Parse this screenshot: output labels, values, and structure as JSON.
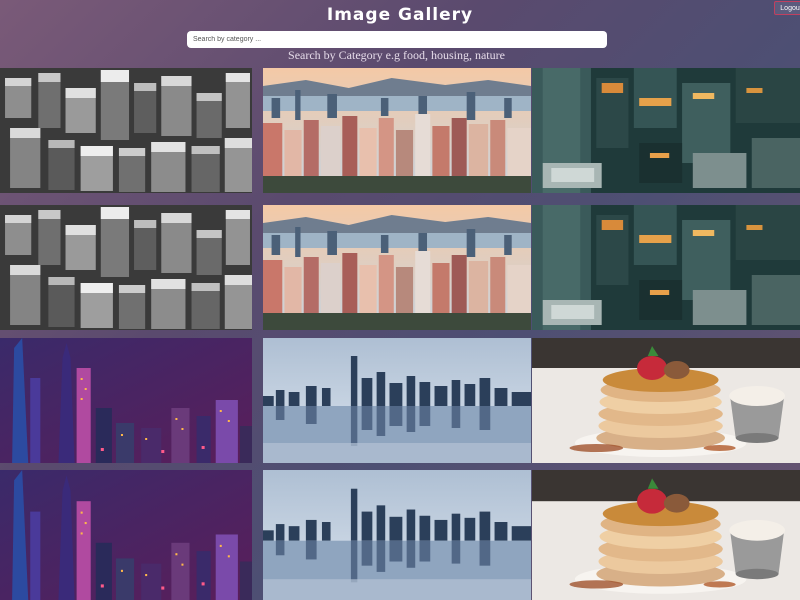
{
  "header": {
    "title": "Image Gallery",
    "logout_label": "Logout",
    "search_placeholder": "Search by category ...",
    "search_value": "",
    "hint": "Search by Category e.g food, housing, nature"
  },
  "gallery": {
    "images": [
      {
        "subject": "bw-city-aerial"
      },
      {
        "subject": "harbor-city-sunset"
      },
      {
        "subject": "teal-orange-rooftops"
      },
      {
        "subject": "bw-city-aerial"
      },
      {
        "subject": "harbor-city-sunset"
      },
      {
        "subject": "teal-orange-rooftops"
      },
      {
        "subject": "purple-night-skyline"
      },
      {
        "subject": "blue-skyline-reflection"
      },
      {
        "subject": "pancake-stack"
      },
      {
        "subject": "purple-night-skyline"
      },
      {
        "subject": "blue-skyline-reflection"
      },
      {
        "subject": "pancake-stack"
      }
    ]
  }
}
